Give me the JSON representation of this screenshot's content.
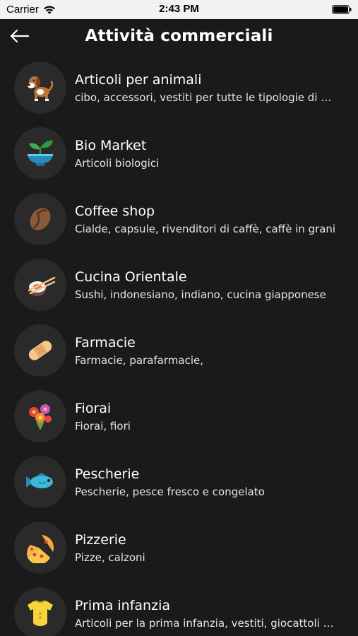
{
  "status_bar": {
    "carrier": "Carrier",
    "time": "2:43 PM"
  },
  "header": {
    "title": "Attività commerciali",
    "back_icon": "arrow-left-icon"
  },
  "categories": [
    {
      "title": "Articoli per animali",
      "subtitle": "cibo, accessori, vestiti per tutte le tipologie di animali",
      "icon": "dog-icon"
    },
    {
      "title": "Bio Market",
      "subtitle": "Articoli biologici",
      "icon": "plant-bowl-icon"
    },
    {
      "title": "Coffee shop",
      "subtitle": "Cialde, capsule, rivenditori di caffè, caffè in grani",
      "icon": "coffee-bean-icon"
    },
    {
      "title": "Cucina Orientale",
      "subtitle": "Sushi, indonesiano, indiano, cucina giapponese",
      "icon": "sushi-icon"
    },
    {
      "title": "Farmacie",
      "subtitle": "Farmacie, parafarmacie,",
      "icon": "bandage-icon"
    },
    {
      "title": "Fiorai",
      "subtitle": "Fiorai, fiori",
      "icon": "flowers-icon"
    },
    {
      "title": "Pescherie",
      "subtitle": "Pescherie, pesce fresco e congelato",
      "icon": "fish-icon"
    },
    {
      "title": "Pizzerie",
      "subtitle": "Pizze, calzoni",
      "icon": "pizza-icon"
    },
    {
      "title": "Prima infanzia",
      "subtitle": "Articoli per la prima infanzia, vestiti, giocattoli e altro",
      "icon": "baby-bodysuit-icon"
    }
  ]
}
